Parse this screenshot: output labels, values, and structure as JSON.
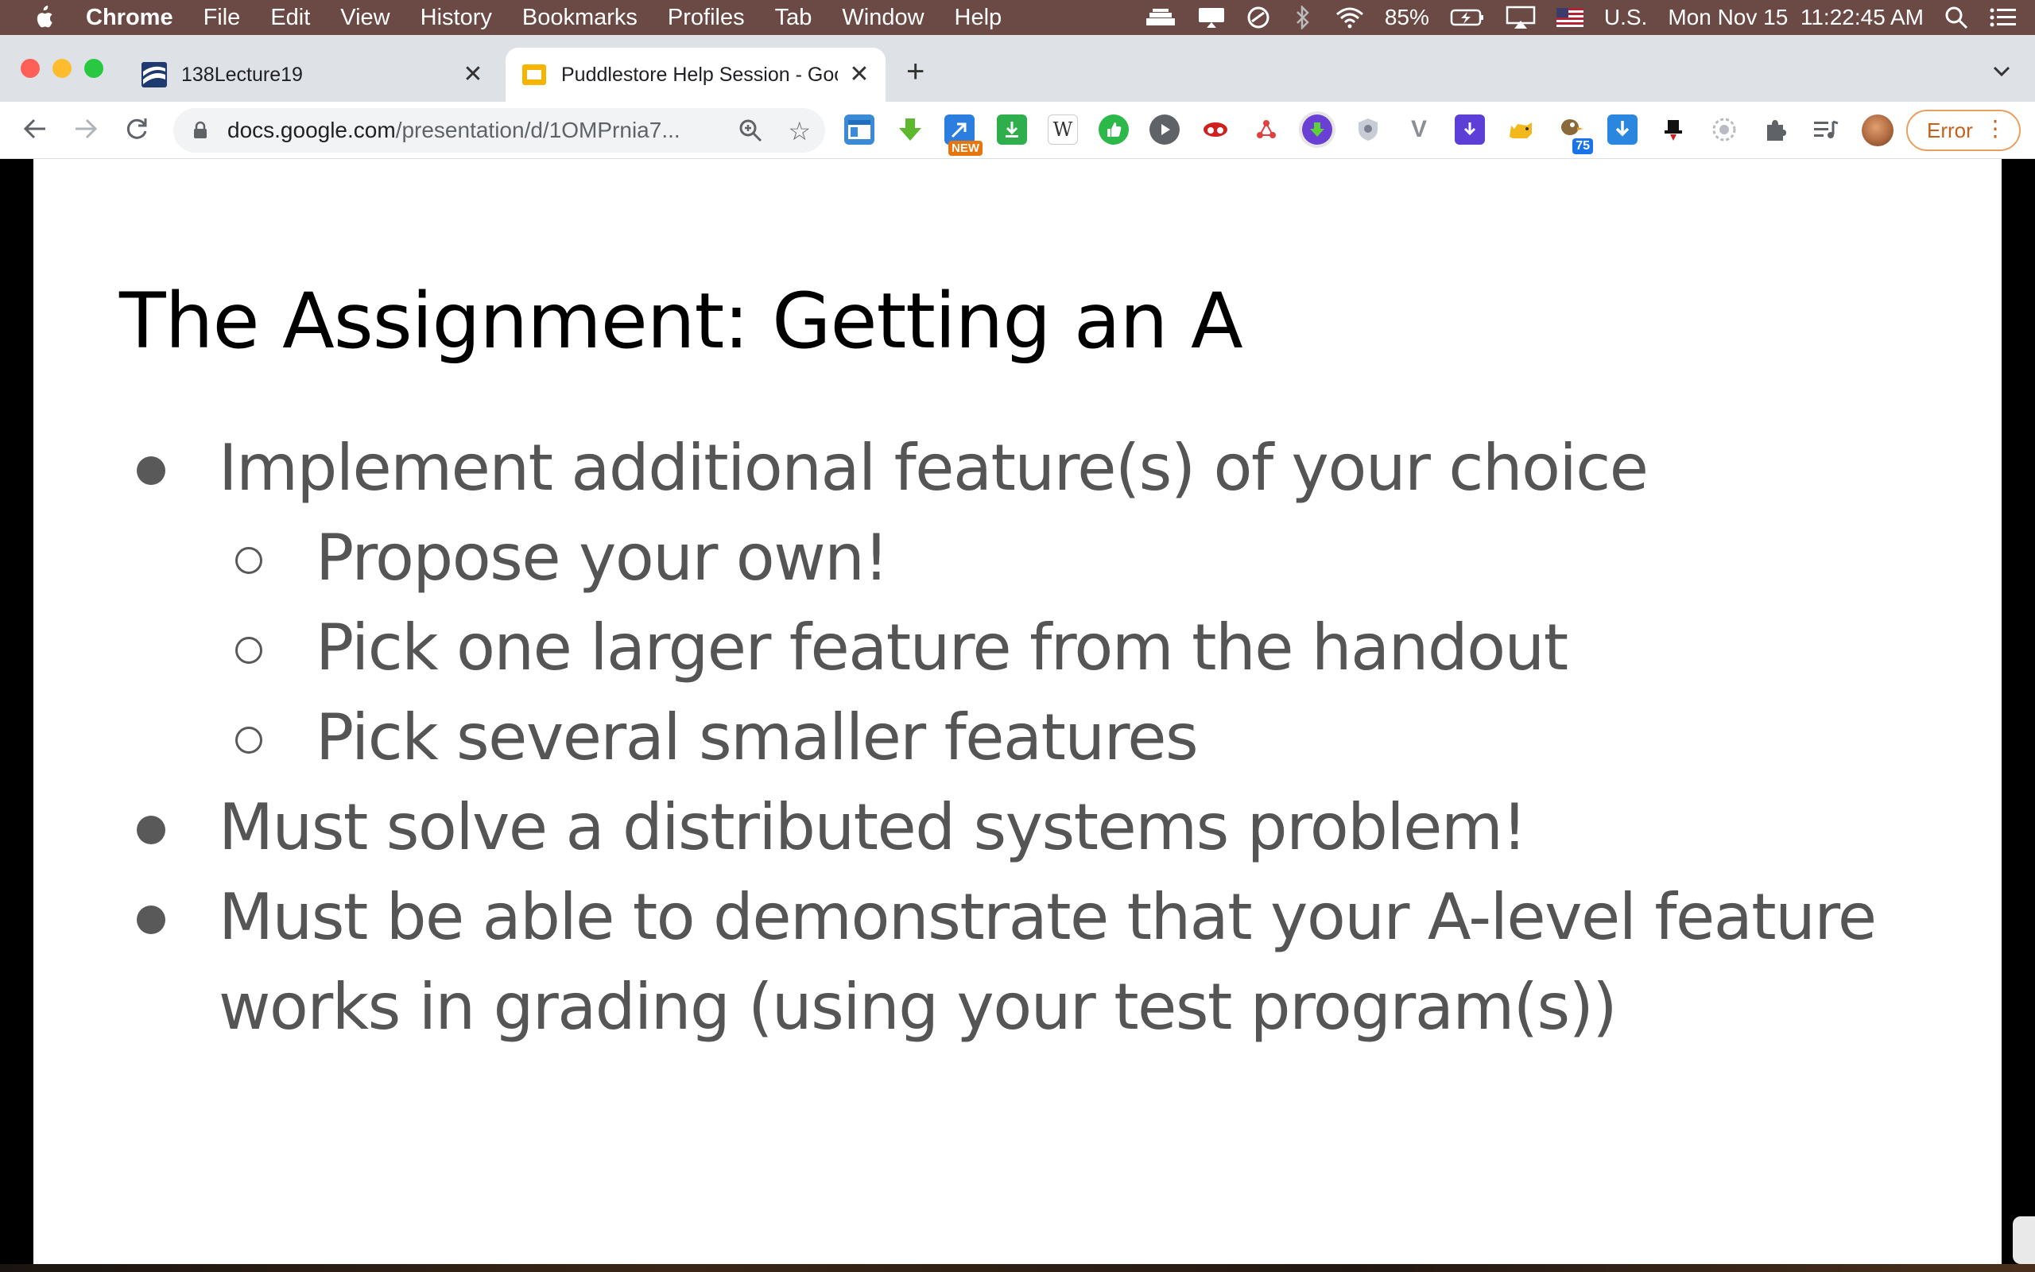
{
  "menubar": {
    "app": "Chrome",
    "items": [
      "File",
      "Edit",
      "View",
      "History",
      "Bookmarks",
      "Profiles",
      "Tab",
      "Window",
      "Help"
    ],
    "battery": "85%",
    "input_source": "U.S.",
    "datetime": "Mon Nov 15  11:22:45 AM"
  },
  "tabs": [
    {
      "label": "138Lecture19",
      "active": false
    },
    {
      "label": "Puddlestore Help Session - Goo",
      "active": true
    }
  ],
  "toolbar": {
    "url_host": "docs.google.com",
    "url_path": "/presentation/d/1OMPrnia7...",
    "ext_new_badge": "NEW",
    "ext_count_badge": "75",
    "error_label": "Error"
  },
  "slide": {
    "title": "The Assignment: Getting an A",
    "bullets": [
      {
        "level": 1,
        "text": "Implement additional feature(s) of your choice"
      },
      {
        "level": 2,
        "text": "Propose your own!"
      },
      {
        "level": 2,
        "text": "Pick one larger feature from the handout"
      },
      {
        "level": 2,
        "text": "Pick several smaller features"
      },
      {
        "level": 1,
        "text": "Must solve a distributed systems problem!"
      },
      {
        "level": 1,
        "text": "Must be able to demonstrate that your A-level feature"
      },
      {
        "level": 1,
        "text": "works in grading (using your test program(s))",
        "continuation": true
      }
    ]
  },
  "colors": {
    "menubar": "#6b4a46",
    "tabstrip": "#dee1e6",
    "bullet_text": "#555555",
    "error_accent": "#c5611a"
  }
}
